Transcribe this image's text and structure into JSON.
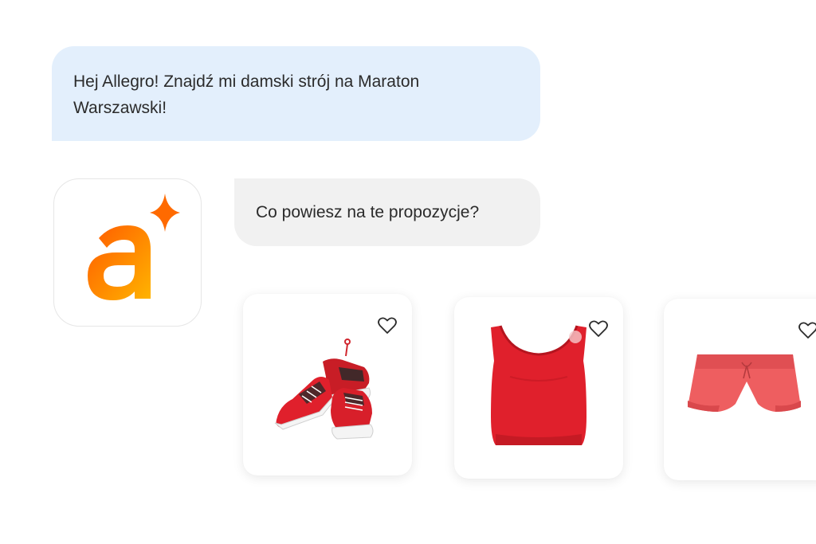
{
  "chat": {
    "user_message": "Hej Allegro! Znajdź mi damski strój na Maraton Warszawski!",
    "bot_message": "Co powiesz na te propozycje?"
  },
  "assistant_avatar": {
    "icon": "allegro-a-sparkle-logo",
    "gradient_from": "#ff5a00",
    "gradient_to": "#ffb400"
  },
  "products": [
    {
      "icon": "red-running-shoes",
      "favorite_icon": "heart-outline-icon"
    },
    {
      "icon": "red-crop-top",
      "favorite_icon": "heart-outline-icon"
    },
    {
      "icon": "coral-running-shorts",
      "favorite_icon": "heart-outline-icon"
    }
  ],
  "colors": {
    "user_bubble": "#e3effc",
    "bot_bubble": "#f1f1f1",
    "text": "#2b2b2b",
    "product_red": "#e0202c",
    "shorts_coral": "#ee5e60"
  }
}
